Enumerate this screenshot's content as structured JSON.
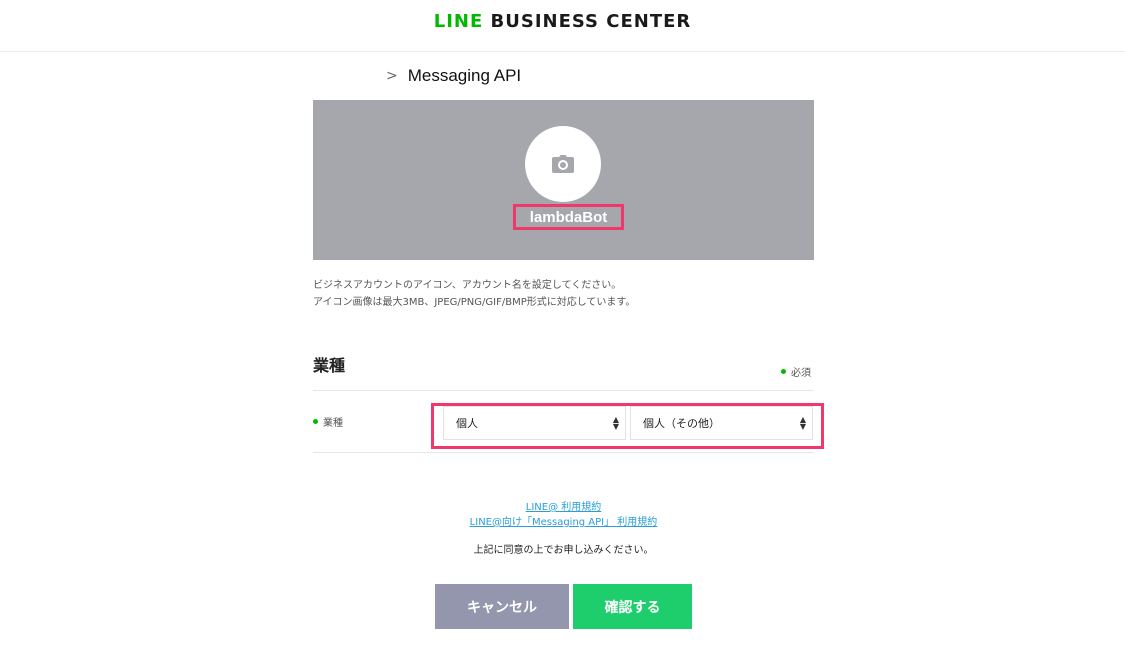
{
  "header": {
    "logo_line": "LINE",
    "logo_rest": " BUSINESS CENTER",
    "brand_color": "#00b900"
  },
  "breadcrumb": {
    "separator": ">",
    "current": "Messaging API"
  },
  "profile": {
    "camera_icon": "camera-icon",
    "account_name": "lambdaBot",
    "banner_color": "#a5a7ad",
    "highlight_color": "#f0386b"
  },
  "description": {
    "line1": "ビジネスアカウントのアイコン、アカウント名を設定してください。",
    "line2": "アイコン画像は最大3MB、JPEG/PNG/GIF/BMP形式に対応しています。"
  },
  "industry_section": {
    "title": "業種",
    "required_label": "必須",
    "field_label": "業種",
    "select1_value": "個人",
    "select2_value": "個人（その他）"
  },
  "terms": {
    "link1": "LINE@ 利用規約",
    "link2": "LINE@向け「Messaging API」 利用規約",
    "agree_text": "上記に同意の上でお申し込みください。"
  },
  "actions": {
    "cancel_label": "キャンセル",
    "confirm_label": "確認する",
    "cancel_color": "#9396ad",
    "confirm_color": "#1ece6c"
  }
}
